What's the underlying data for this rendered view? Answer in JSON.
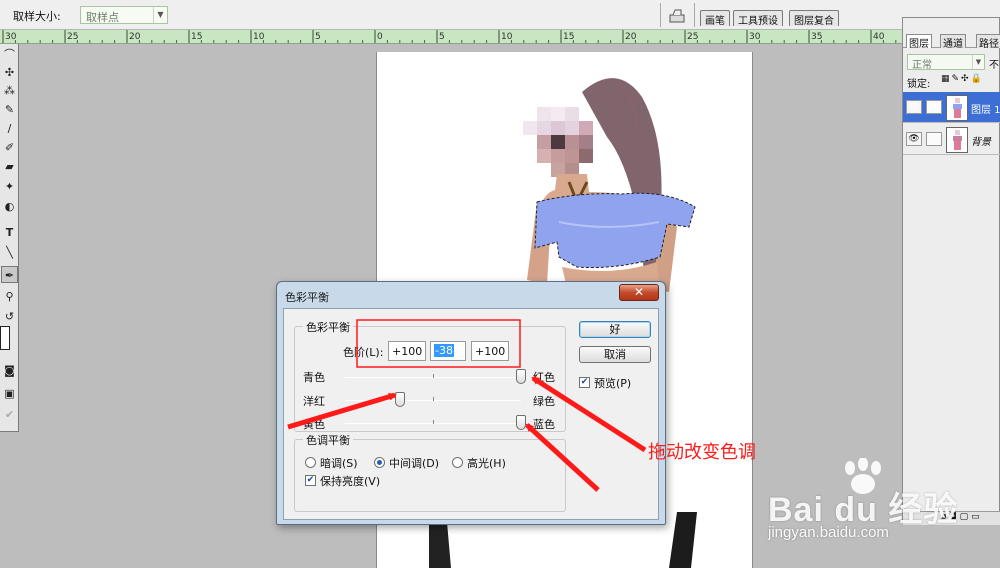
{
  "options_bar": {
    "sample_size_label": "取样大小:",
    "sample_size_value": "取样点"
  },
  "window_tabs": [
    "画笔",
    "工具预设",
    "图层复合"
  ],
  "ruler": {
    "labels": [
      "30",
      "25",
      "20",
      "15",
      "10",
      "5",
      "0",
      "5",
      "10",
      "15",
      "20",
      "25",
      "30",
      "35",
      "40"
    ]
  },
  "layers_panel": {
    "tabs": [
      "图层",
      "通道",
      "路径"
    ],
    "blend_mode": "正常",
    "opacity_label": "不",
    "lock_label": "锁定:",
    "layers": [
      {
        "name": "图层 1",
        "selected": true
      },
      {
        "name": "背景",
        "selected": false
      }
    ]
  },
  "dialog": {
    "title": "色彩平衡",
    "close_label": "✕",
    "color_balance_group": "色彩平衡",
    "levels_label": "色阶(L):",
    "levels": [
      "+100",
      "-38",
      "+100"
    ],
    "sliders": [
      {
        "left": "青色",
        "right": "红色",
        "value": 100
      },
      {
        "left": "洋红",
        "right": "绿色",
        "value": -38
      },
      {
        "left": "黄色",
        "right": "蓝色",
        "value": 100
      }
    ],
    "tone_group": "色调平衡",
    "tone_options": [
      {
        "label": "暗调(S)",
        "checked": false
      },
      {
        "label": "中间调(D)",
        "checked": true
      },
      {
        "label": "高光(H)",
        "checked": false
      }
    ],
    "preserve_luminosity": {
      "label": "保持亮度(V)",
      "checked": true
    },
    "ok_label": "好",
    "cancel_label": "取消",
    "preview": {
      "label": "预览(P)",
      "checked": true
    }
  },
  "annotation": {
    "text": "拖动改变色调",
    "color": "#ff1a1a"
  },
  "watermark": {
    "brand": "Bai du 经验",
    "url": "jingyan.baidu.com"
  },
  "colors": {
    "ruler_bg": "#c7e6c1",
    "selected_layer": "#3d6ed3",
    "dialog_frame": "#c8d9ea"
  }
}
